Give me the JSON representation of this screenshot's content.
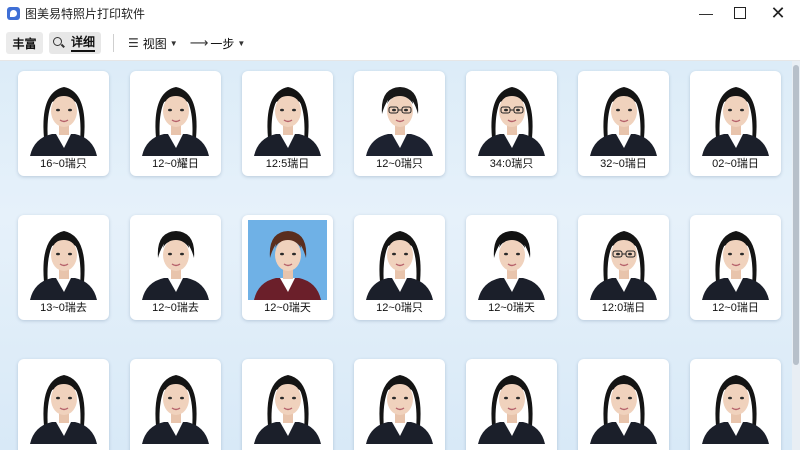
{
  "window": {
    "title": "图美易特照片打印软件",
    "icon": "app-logo-icon"
  },
  "toolbar": {
    "tab1": "丰富",
    "tab2": "详细",
    "tab3": "视图",
    "tab4": "一步"
  },
  "photos": [
    {
      "caption": "16~0瑞只",
      "bg": "#ffffff",
      "hair": "#141414",
      "suit": "#1b1f2a",
      "shirt": "#ffffff",
      "glasses": false,
      "short": false
    },
    {
      "caption": "12~0耀日",
      "bg": "#ffffff",
      "hair": "#151515",
      "suit": "#1b1f2a",
      "shirt": "#ffffff",
      "glasses": false,
      "short": false
    },
    {
      "caption": "12:5瑞日",
      "bg": "#ffffff",
      "hair": "#131313",
      "suit": "#1b1f2a",
      "shirt": "#ffffff",
      "glasses": false,
      "short": false
    },
    {
      "caption": "12~0瑞只",
      "bg": "#ffffff",
      "hair": "#181818",
      "suit": "#1d2230",
      "shirt": "#ffffff",
      "glasses": true,
      "short": true
    },
    {
      "caption": "34:0瑞只",
      "bg": "#ffffff",
      "hair": "#141414",
      "suit": "#1b1f2a",
      "shirt": "#ffffff",
      "glasses": true,
      "short": false
    },
    {
      "caption": "32~0瑞日",
      "bg": "#ffffff",
      "hair": "#141414",
      "suit": "#1b1f2a",
      "shirt": "#ffffff",
      "glasses": false,
      "short": false
    },
    {
      "caption": "02~0瑞日",
      "bg": "#ffffff",
      "hair": "#141414",
      "suit": "#1b1f2a",
      "shirt": "#ffffff",
      "glasses": false,
      "short": false
    },
    {
      "caption": "13~0瑞去",
      "bg": "#ffffff",
      "hair": "#141414",
      "suit": "#1b1f2a",
      "shirt": "#ffffff",
      "glasses": false,
      "short": false
    },
    {
      "caption": "12~0瑞去",
      "bg": "#ffffff",
      "hair": "#151515",
      "suit": "#1b1f2a",
      "shirt": "#ffffff",
      "glasses": false,
      "short": true
    },
    {
      "caption": "12~0瑞天",
      "bg": "#6fb1e6",
      "hair": "#5a2e1e",
      "suit": "#6b1f2a",
      "shirt": "#ffffff",
      "glasses": false,
      "short": true
    },
    {
      "caption": "12~0瑞只",
      "bg": "#ffffff",
      "hair": "#141414",
      "suit": "#1b1f2a",
      "shirt": "#ffffff",
      "glasses": false,
      "short": false
    },
    {
      "caption": "12~0瑞天",
      "bg": "#ffffff",
      "hair": "#121212",
      "suit": "#1b1f2a",
      "shirt": "#ffffff",
      "glasses": false,
      "short": true
    },
    {
      "caption": "12:0瑞日",
      "bg": "#ffffff",
      "hair": "#141414",
      "suit": "#1b1f2a",
      "shirt": "#ffffff",
      "glasses": true,
      "short": false
    },
    {
      "caption": "12~0瑞日",
      "bg": "#ffffff",
      "hair": "#141414",
      "suit": "#1b1f2a",
      "shirt": "#ffffff",
      "glasses": false,
      "short": false
    },
    {
      "caption": "",
      "bg": "#ffffff",
      "hair": "#141414",
      "suit": "#1b1f2a",
      "shirt": "#ffffff",
      "glasses": false,
      "short": false
    },
    {
      "caption": "",
      "bg": "#ffffff",
      "hair": "#141414",
      "suit": "#1b1f2a",
      "shirt": "#ffffff",
      "glasses": false,
      "short": false
    },
    {
      "caption": "",
      "bg": "#ffffff",
      "hair": "#141414",
      "suit": "#1b1f2a",
      "shirt": "#ffffff",
      "glasses": false,
      "short": false
    },
    {
      "caption": "",
      "bg": "#ffffff",
      "hair": "#141414",
      "suit": "#1b1f2a",
      "shirt": "#ffffff",
      "glasses": false,
      "short": false
    },
    {
      "caption": "",
      "bg": "#ffffff",
      "hair": "#141414",
      "suit": "#1b1f2a",
      "shirt": "#ffffff",
      "glasses": false,
      "short": false
    },
    {
      "caption": "",
      "bg": "#ffffff",
      "hair": "#141414",
      "suit": "#1b1f2a",
      "shirt": "#ffffff",
      "glasses": false,
      "short": false
    },
    {
      "caption": "",
      "bg": "#ffffff",
      "hair": "#141414",
      "suit": "#1b1f2a",
      "shirt": "#ffffff",
      "glasses": false,
      "short": false
    }
  ]
}
